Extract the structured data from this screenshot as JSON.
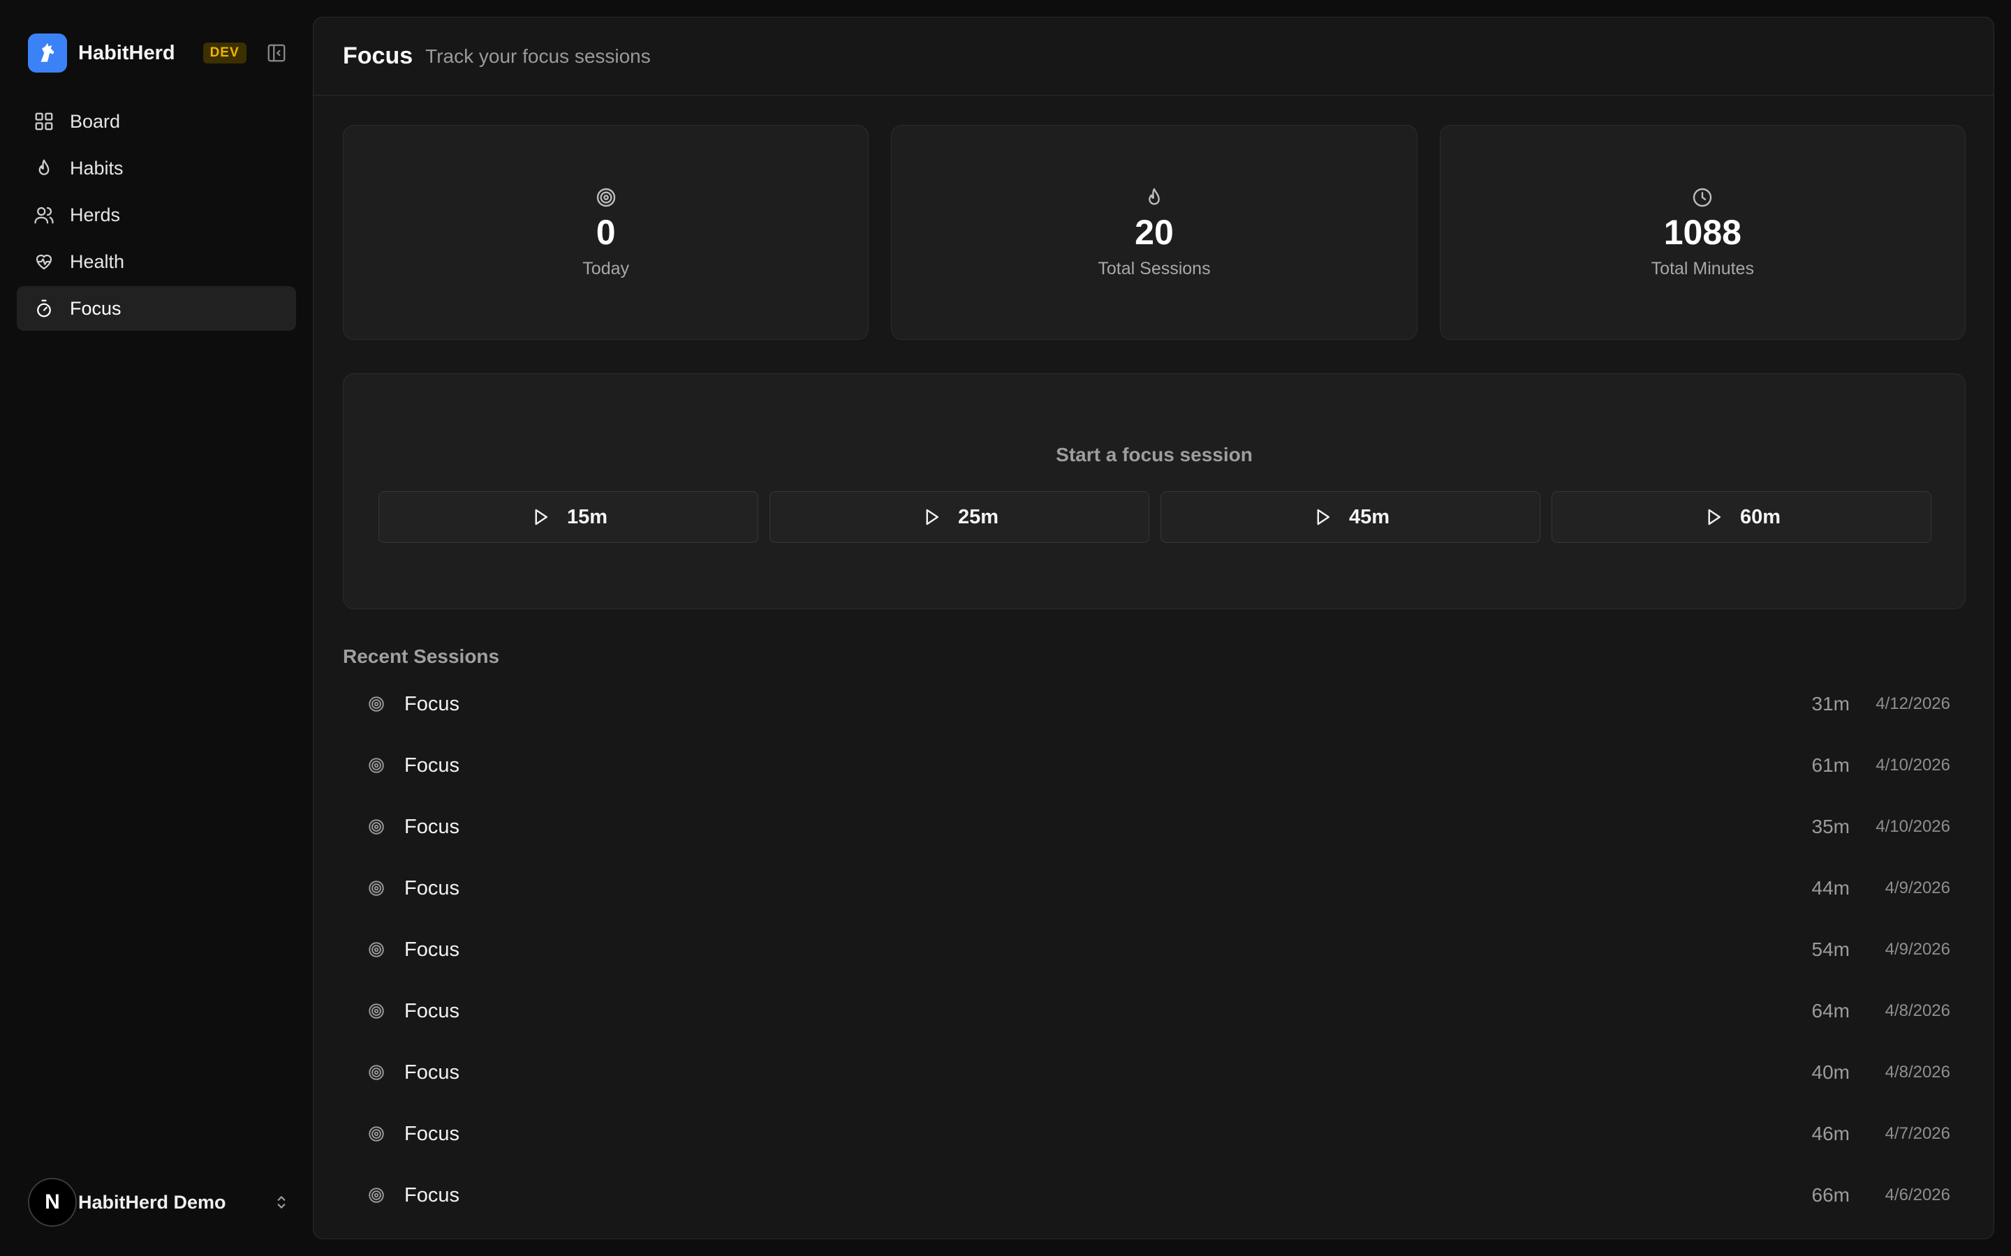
{
  "app": {
    "name": "HabitHerd",
    "env_badge": "DEV"
  },
  "sidebar": {
    "items": [
      {
        "label": "Board",
        "icon": "grid-icon"
      },
      {
        "label": "Habits",
        "icon": "flame-icon"
      },
      {
        "label": "Herds",
        "icon": "users-icon"
      },
      {
        "label": "Health",
        "icon": "heart-pulse-icon"
      },
      {
        "label": "Focus",
        "icon": "timer-icon",
        "active": true
      }
    ]
  },
  "user": {
    "avatar_letter": "N",
    "name": "HabitHerd Demo"
  },
  "header": {
    "title": "Focus",
    "subtitle": "Track your focus sessions"
  },
  "stats": [
    {
      "value": "0",
      "label": "Today",
      "icon": "target-icon"
    },
    {
      "value": "20",
      "label": "Total Sessions",
      "icon": "flame-icon"
    },
    {
      "value": "1088",
      "label": "Total Minutes",
      "icon": "clock-icon"
    }
  ],
  "start": {
    "title": "Start a focus session",
    "durations": [
      "15m",
      "25m",
      "45m",
      "60m"
    ]
  },
  "recent": {
    "title": "Recent Sessions",
    "sessions": [
      {
        "name": "Focus",
        "duration": "31m",
        "date": "4/12/2026"
      },
      {
        "name": "Focus",
        "duration": "61m",
        "date": "4/10/2026"
      },
      {
        "name": "Focus",
        "duration": "35m",
        "date": "4/10/2026"
      },
      {
        "name": "Focus",
        "duration": "44m",
        "date": "4/9/2026"
      },
      {
        "name": "Focus",
        "duration": "54m",
        "date": "4/9/2026"
      },
      {
        "name": "Focus",
        "duration": "64m",
        "date": "4/8/2026"
      },
      {
        "name": "Focus",
        "duration": "40m",
        "date": "4/8/2026"
      },
      {
        "name": "Focus",
        "duration": "46m",
        "date": "4/7/2026"
      },
      {
        "name": "Focus",
        "duration": "66m",
        "date": "4/6/2026"
      }
    ]
  },
  "colors": {
    "accent": "#3b82f6",
    "badge_text": "#f4b400",
    "panel": "#171717",
    "card": "#1e1e1e"
  }
}
